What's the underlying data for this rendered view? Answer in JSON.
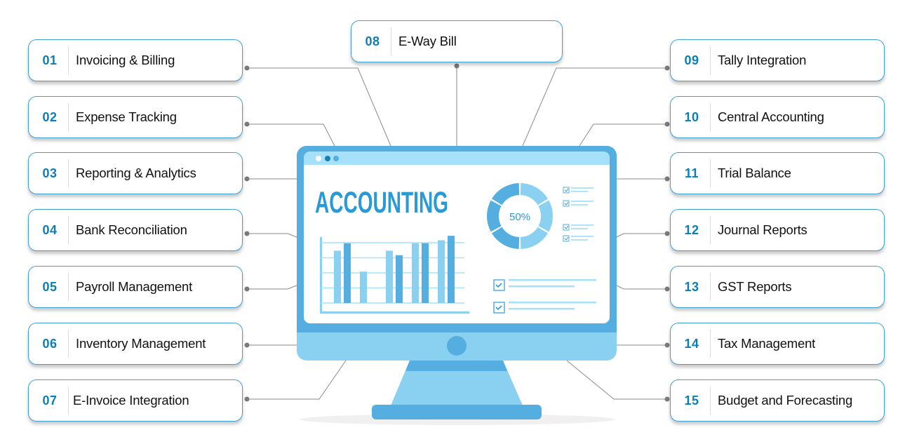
{
  "diagram": {
    "center_title": "ACCOUNTING",
    "donut_label": "50%",
    "colors": {
      "accent": "#0b7fb5",
      "card_border": "#3da2d8",
      "monitor_frame": "#55aee0",
      "monitor_light": "#89d0f1",
      "screen_bar": "#a6e1fb",
      "connector": "#8a8a8a"
    },
    "features": [
      {
        "num": "01",
        "label": "Invoicing & Billing"
      },
      {
        "num": "02",
        "label": "Expense Tracking"
      },
      {
        "num": "03",
        "label": "Reporting & Analytics"
      },
      {
        "num": "04",
        "label": "Bank Reconciliation"
      },
      {
        "num": "05",
        "label": "Payroll Management"
      },
      {
        "num": "06",
        "label": "Inventory Management"
      },
      {
        "num": "07",
        "label": "E-Invoice Integration"
      },
      {
        "num": "08",
        "label": "E-Way Bill"
      },
      {
        "num": "09",
        "label": "Tally Integration"
      },
      {
        "num": "10",
        "label": "Central Accounting"
      },
      {
        "num": "11",
        "label": "Trial Balance"
      },
      {
        "num": "12",
        "label": "Journal Reports"
      },
      {
        "num": "13",
        "label": "GST Reports"
      },
      {
        "num": "14",
        "label": "Tax Management"
      },
      {
        "num": "15",
        "label": "Budget and Forecasting"
      }
    ],
    "screen_bar_chart": {
      "groups": [
        {
          "light": 3.5,
          "dark": 4.0
        },
        {
          "light": 2.1,
          "dark": null
        },
        {
          "light": 3.5,
          "dark": 3.2
        },
        {
          "light": 4.0,
          "dark": 4.0
        },
        {
          "light": 4.2,
          "dark": 4.5
        }
      ],
      "max": 4.6
    },
    "donut_segments": 6
  }
}
